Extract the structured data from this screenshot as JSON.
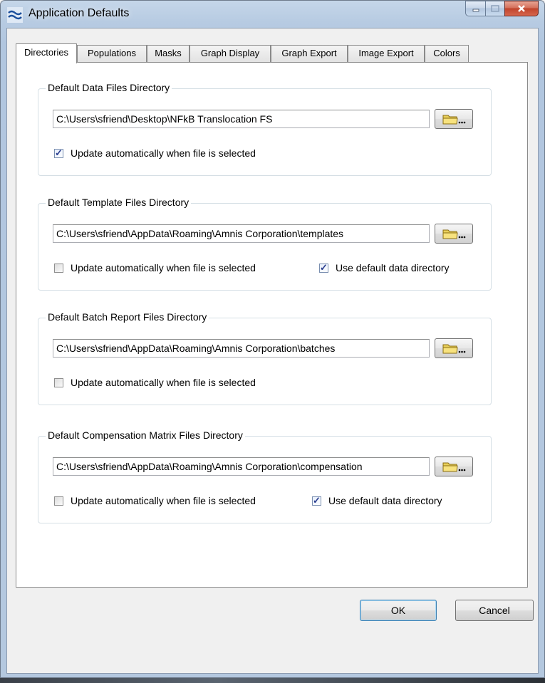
{
  "window": {
    "title": "Application Defaults",
    "app_icon": "waves-icon"
  },
  "tabs": [
    {
      "label": "Directories",
      "active": true
    },
    {
      "label": "Populations",
      "active": false
    },
    {
      "label": "Masks",
      "active": false
    },
    {
      "label": "Graph Display",
      "active": false
    },
    {
      "label": "Graph Export",
      "active": false
    },
    {
      "label": "Image Export",
      "active": false
    },
    {
      "label": "Colors",
      "active": false
    }
  ],
  "groups": {
    "data_files": {
      "title": "Default Data Files Directory",
      "path": "C:\\Users\\sfriend\\Desktop\\NFkB Translocation FS",
      "auto_update_label": "Update automatically when file is selected",
      "auto_update_checked": true
    },
    "template_files": {
      "title": "Default Template Files Directory",
      "path": "C:\\Users\\sfriend\\AppData\\Roaming\\Amnis Corporation\\templates",
      "auto_update_label": "Update automatically when file is selected",
      "auto_update_checked": false,
      "use_default_label": "Use default data directory",
      "use_default_checked": true
    },
    "batch_report_files": {
      "title": "Default Batch Report Files Directory",
      "path": "C:\\Users\\sfriend\\AppData\\Roaming\\Amnis Corporation\\batches",
      "auto_update_label": "Update automatically when file is selected",
      "auto_update_checked": false
    },
    "compensation_files": {
      "title": "Default Compensation Matrix Files Directory",
      "path": "C:\\Users\\sfriend\\AppData\\Roaming\\Amnis Corporation\\compensation",
      "auto_update_label": "Update automatically when file is selected",
      "auto_update_checked": false,
      "use_default_label": "Use default data directory",
      "use_default_checked": true
    }
  },
  "browse_button": {
    "label": "...",
    "icon": "folder-icon"
  },
  "buttons": {
    "ok": "OK",
    "cancel": "Cancel"
  }
}
